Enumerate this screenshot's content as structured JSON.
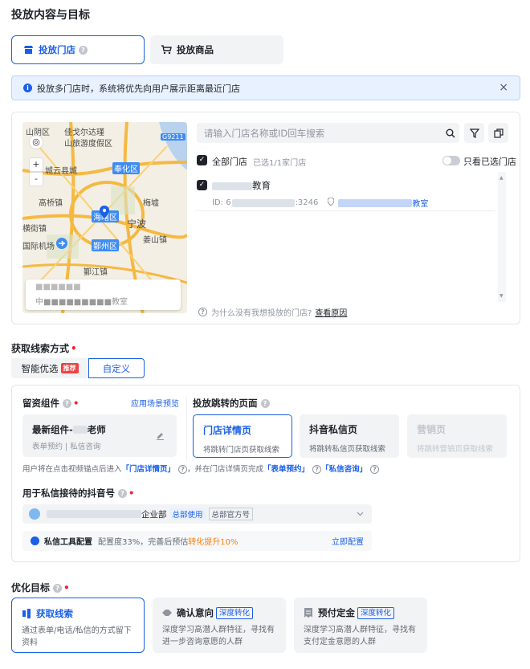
{
  "page_title": "投放内容与目标",
  "tabs": [
    {
      "label": "投放门店",
      "icon": "store-icon"
    },
    {
      "label": "投放商品",
      "icon": "cart-icon"
    }
  ],
  "notice": {
    "text": "投放多门店时，系统将优先向用户展示距离最近门店",
    "close": "×"
  },
  "map": {
    "labels": [
      "山阴区",
      "佳戈尔达瑾",
      "山旅游度假区",
      "G9211",
      "城云县城",
      "国际机场",
      "宁波",
      "海曙区",
      "鄞州区",
      "鄞江镇",
      "奉化区",
      "横街镇",
      "高桥镇",
      "姜山镇",
      "梅墟"
    ],
    "card_line1": "■■■■■■",
    "card_line2": "中■■■■■■■■■教室"
  },
  "search": {
    "placeholder": "请输入门店名称或ID回车搜索"
  },
  "store_list": {
    "all_label": "全部门店",
    "selected_count": "已选1/1家门店",
    "only_selected": "只看已选门店",
    "store_name_suffix": "教育",
    "store_id_prefix": "ID: 6",
    "store_id_suffix": ":3246",
    "store_addr_suffix": "教室",
    "why_text": "为什么没有我想投放的门店?",
    "why_link": "查看原因"
  },
  "lead": {
    "title": "获取线索方式",
    "options": [
      "智能优选",
      "自定义"
    ],
    "recommend_badge": "推荐"
  },
  "component": {
    "title": "留资组件",
    "preview_link": "应用场景预览",
    "name_prefix": "最新组件-",
    "name_suffix": "老师",
    "sub": "表单预约 | 私信咨询"
  },
  "jump": {
    "title": "投放跳转的页面",
    "options": [
      {
        "title": "门店详情页",
        "desc": "将跳转门店页获取线索"
      },
      {
        "title": "抖音私信页",
        "desc": "将跳转私信页获取线索"
      },
      {
        "title": "营销页",
        "desc": "将跳转营销页获取线索"
      }
    ]
  },
  "hint": {
    "p1": "用户将在点击视频锚点后进入",
    "l1": "「门店详情页」",
    "p2": "，并在门店详情页完成",
    "l2": "「表单预约」",
    "l3": "「私信咨询」"
  },
  "douyin": {
    "title": "用于私信接待的抖音号",
    "account_suffix": "企业部",
    "tag1": "总部使用",
    "tag2": "总部官方号"
  },
  "tool": {
    "title": "私信工具配置",
    "desc_prefix": "配置度33%，完善后预估",
    "desc_hl": "转化提升10%",
    "action": "立即配置"
  },
  "goal": {
    "title": "优化目标",
    "options": [
      {
        "title": "获取线索",
        "tag": "",
        "desc": "通过表单/电话/私信的方式留下资料"
      },
      {
        "title": "确认意向",
        "tag": "深度转化",
        "desc": "深度学习高潜人群特征，寻找有进一步咨询意愿的人群"
      },
      {
        "title": "预付定金",
        "tag": "深度转化",
        "desc": "深度学习高潜人群特征，寻找有支付定金意愿的人群"
      }
    ]
  },
  "colors": {
    "accent": "#1a5fe8",
    "danger": "#f53f3f",
    "notice_bg": "#e8f1ff"
  }
}
